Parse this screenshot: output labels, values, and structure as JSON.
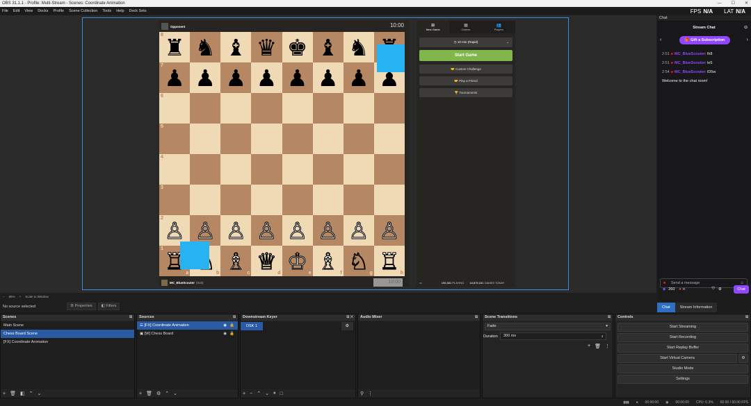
{
  "window": {
    "title": "OBS 31.1.1 - Profile: Multi-Stream - Scenes: Coordinate Animation"
  },
  "menu": [
    "File",
    "Edit",
    "View",
    "Docks",
    "Profile",
    "Scene Collection",
    "Tools",
    "Help",
    "Dock Sets"
  ],
  "stats": {
    "fps_label": "FPS",
    "fps_value": "N/A",
    "lat_label": "LAT",
    "lat_value": "N/A"
  },
  "game": {
    "opponent": "Opponent",
    "opponent_clock": "10:00",
    "player": "MC_BlueScouter",
    "player_rating": "(918)",
    "player_clock": "10:00",
    "ranks": [
      "8",
      "7",
      "6",
      "5",
      "4",
      "3",
      "2",
      "1"
    ],
    "files": [
      "a",
      "b",
      "c",
      "d",
      "e",
      "f",
      "g",
      "h"
    ],
    "board": [
      [
        "♜",
        "♞",
        "♝",
        "♛",
        "♚",
        "♝",
        "♞",
        "♜"
      ],
      [
        "♟",
        "♟",
        "♟",
        "♟",
        "♟",
        "♟",
        "♟",
        "♟"
      ],
      [
        "",
        "",
        "",
        "",
        "",
        "",
        "",
        ""
      ],
      [
        "",
        "",
        "",
        "",
        "",
        "",
        "",
        ""
      ],
      [
        "",
        "",
        "",
        "",
        "",
        "",
        "",
        ""
      ],
      [
        "",
        "",
        "",
        "",
        "",
        "",
        "",
        ""
      ],
      [
        "♙",
        "♙",
        "♙",
        "♙",
        "♙",
        "♙",
        "♙",
        "♙"
      ],
      [
        "♖",
        "♘",
        "♗",
        "♕",
        "♔",
        "♗",
        "♘",
        "♖"
      ]
    ]
  },
  "side": {
    "tabs": [
      {
        "icon": "⊞",
        "label": "New Game"
      },
      {
        "icon": "▦",
        "label": "Games"
      },
      {
        "icon": "👥",
        "label": "Players"
      }
    ],
    "time_control": "10 min (Rapid)",
    "start": "Start Game",
    "custom": "Custom Challenge",
    "friend": "Play a Friend",
    "tournaments": "Tournaments",
    "playing_count": "196,681",
    "playing_label": "PLAYING",
    "games_count": "18,875,181",
    "games_label": "GAMES TODAY"
  },
  "chat": {
    "dock_title": "Chat",
    "header": "Stream Chat",
    "gift": "Gift a Subscription",
    "messages": [
      {
        "time": "2:51",
        "user": "MC_BlueScouter",
        "text": ": lh8"
      },
      {
        "time": "2:51",
        "user": "MC_BlueScouter",
        "text": ": le5"
      },
      {
        "time": "2:54",
        "user": "MC_BlueScouter",
        "text": ": lD5w"
      }
    ],
    "welcome": "Welcome to the chat room!",
    "send_placeholder": "Send a message",
    "points": "260",
    "infinity": "∞",
    "chat_button": "Chat",
    "tab_chat": "Chat",
    "tab_info": "Stream Information"
  },
  "preview": {
    "zoom": "86%",
    "scale": "Scale to Window"
  },
  "source_bar": {
    "none": "No source selected",
    "properties": "Properties",
    "filters": "Filters"
  },
  "scenes": {
    "title": "Scenes",
    "items": [
      "Main Scene",
      "Chess Board Scene",
      "[FX] Coordinate Animation"
    ],
    "selected": 1
  },
  "sources": {
    "title": "Sources",
    "items": [
      "[FX] Coordinate Animation",
      "[W] Chess Board"
    ]
  },
  "dsk": {
    "title": "Downstream Keyer",
    "tab": "DSK 1"
  },
  "mixer": {
    "title": "Audio Mixer"
  },
  "transitions": {
    "title": "Scene Transitions",
    "type": "Fade",
    "duration_label": "Duration",
    "duration": "300 ms"
  },
  "controls": {
    "title": "Controls",
    "buttons": [
      "Start Streaming",
      "Start Recording",
      "Start Replay Buffer",
      "Start Virtual Camera",
      "Studio Mode",
      "Settings"
    ]
  },
  "status": {
    "rec_time": "00:00:00",
    "stream_time": "00:00:00",
    "cpu": "CPU: 0.3%",
    "fps": "60.00 / 60.00 FPS"
  },
  "colors": {
    "accent": "#3c8de6",
    "twitch": "#9147ff",
    "chess_green": "#81b64c",
    "overlay_blue": "#27b2f2"
  }
}
